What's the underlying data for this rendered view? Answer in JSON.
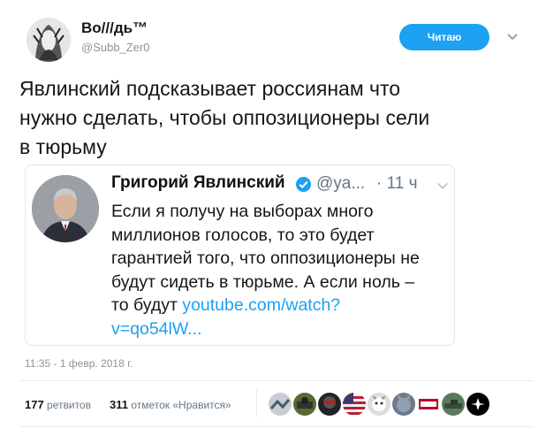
{
  "author": {
    "display_name": "Во///дь™",
    "handle": "@Subb_Zer0"
  },
  "follow_button": {
    "label": "Читаю"
  },
  "tweet": {
    "text_lines": [
      "Явлинский подсказывает россиянам что",
      "нужно сделать, чтобы оппозиционеры сели",
      "в тюрьму"
    ],
    "timestamp": "11:35 - 1 февр. 2018 г."
  },
  "quoted": {
    "name": "Григорий Явлинский",
    "handle": "@ya...",
    "time": "· 11 ч",
    "text_lines": [
      "Если я получу на выборах много",
      "миллионов голосов, то это будет",
      "гарантией того, что оппозиционеры не",
      "будут сидеть в тюрьме. А если ноль –"
    ],
    "text_last_prefix": "то будут ",
    "link_line1": "youtube.com/watch?",
    "link_line2": "v=qo54lW..."
  },
  "stats": {
    "retweets_count": "177",
    "retweets_label": "ретвитов",
    "likes_count": "311",
    "likes_label": "отметок «Нравится»"
  },
  "colors": {
    "accent": "#1da1f2",
    "secondary_text": "#657786"
  }
}
